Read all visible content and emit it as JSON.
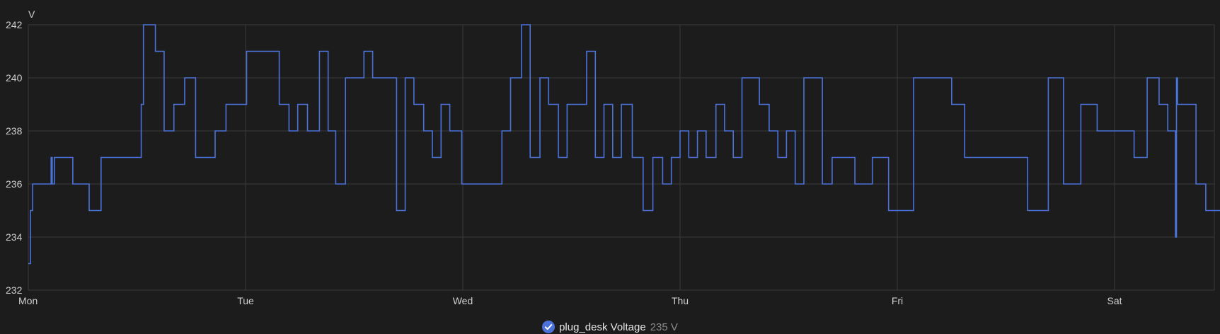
{
  "colors": {
    "background": "#1c1c1c",
    "grid": "#3a3a3a",
    "series": "#4a72d9",
    "text": "#d0d0d0",
    "legend_value": "#8a8a8a"
  },
  "legend": {
    "icon": "check-circle-icon",
    "name": "plug_desk Voltage",
    "value": "235 V"
  },
  "chart_data": {
    "type": "line",
    "step": true,
    "ylabel": "V",
    "ylim": [
      232,
      242
    ],
    "yticks": [
      232,
      234,
      236,
      238,
      240,
      242
    ],
    "xlim": [
      0,
      5.55
    ],
    "xticks": [
      {
        "value": 0,
        "label": "Mon"
      },
      {
        "value": 1,
        "label": "Tue"
      },
      {
        "value": 2,
        "label": "Wed"
      },
      {
        "value": 3,
        "label": "Thu"
      },
      {
        "value": 4,
        "label": "Fri"
      },
      {
        "value": 5,
        "label": "Sat"
      }
    ],
    "grid": true,
    "legend_position": "bottom-center",
    "series": [
      {
        "name": "plug_desk Voltage",
        "points": [
          [
            0.0,
            233
          ],
          [
            0.01,
            235
          ],
          [
            0.02,
            236
          ],
          [
            0.105,
            237
          ],
          [
            0.11,
            236
          ],
          [
            0.12,
            237
          ],
          [
            0.205,
            236
          ],
          [
            0.28,
            235
          ],
          [
            0.335,
            237
          ],
          [
            0.52,
            239
          ],
          [
            0.53,
            242
          ],
          [
            0.585,
            241
          ],
          [
            0.625,
            238
          ],
          [
            0.67,
            239
          ],
          [
            0.72,
            240
          ],
          [
            0.77,
            237
          ],
          [
            0.86,
            238
          ],
          [
            0.91,
            239
          ],
          [
            1.005,
            241
          ],
          [
            1.155,
            239
          ],
          [
            1.2,
            238
          ],
          [
            1.24,
            239
          ],
          [
            1.285,
            238
          ],
          [
            1.34,
            241
          ],
          [
            1.38,
            238
          ],
          [
            1.415,
            236
          ],
          [
            1.46,
            240
          ],
          [
            1.545,
            241
          ],
          [
            1.585,
            240
          ],
          [
            1.695,
            235
          ],
          [
            1.735,
            240
          ],
          [
            1.775,
            239
          ],
          [
            1.82,
            238
          ],
          [
            1.86,
            237
          ],
          [
            1.9,
            239
          ],
          [
            1.94,
            238
          ],
          [
            1.995,
            236
          ],
          [
            2.18,
            238
          ],
          [
            2.22,
            240
          ],
          [
            2.27,
            242
          ],
          [
            2.31,
            237
          ],
          [
            2.355,
            240
          ],
          [
            2.395,
            239
          ],
          [
            2.44,
            237
          ],
          [
            2.48,
            239
          ],
          [
            2.57,
            241
          ],
          [
            2.61,
            237
          ],
          [
            2.65,
            239
          ],
          [
            2.69,
            237
          ],
          [
            2.73,
            239
          ],
          [
            2.78,
            237
          ],
          [
            2.83,
            235
          ],
          [
            2.875,
            237
          ],
          [
            2.92,
            236
          ],
          [
            2.96,
            237
          ],
          [
            3.0,
            238
          ],
          [
            3.04,
            237
          ],
          [
            3.08,
            238
          ],
          [
            3.12,
            237
          ],
          [
            3.165,
            239
          ],
          [
            3.205,
            238
          ],
          [
            3.245,
            237
          ],
          [
            3.285,
            240
          ],
          [
            3.365,
            239
          ],
          [
            3.41,
            238
          ],
          [
            3.45,
            237
          ],
          [
            3.49,
            238
          ],
          [
            3.53,
            236
          ],
          [
            3.57,
            240
          ],
          [
            3.655,
            236
          ],
          [
            3.7,
            237
          ],
          [
            3.805,
            236
          ],
          [
            3.885,
            237
          ],
          [
            3.96,
            235
          ],
          [
            4.075,
            240
          ],
          [
            4.25,
            239
          ],
          [
            4.31,
            237
          ],
          [
            4.6,
            235
          ],
          [
            4.695,
            240
          ],
          [
            4.765,
            236
          ],
          [
            4.845,
            239
          ],
          [
            4.92,
            238
          ],
          [
            5.09,
            237
          ],
          [
            5.15,
            240
          ],
          [
            5.205,
            239
          ],
          [
            5.245,
            238
          ],
          [
            5.28,
            234
          ],
          [
            5.285,
            240
          ],
          [
            5.29,
            239
          ],
          [
            5.375,
            236
          ],
          [
            5.42,
            235
          ],
          [
            5.55,
            235
          ]
        ]
      }
    ]
  }
}
